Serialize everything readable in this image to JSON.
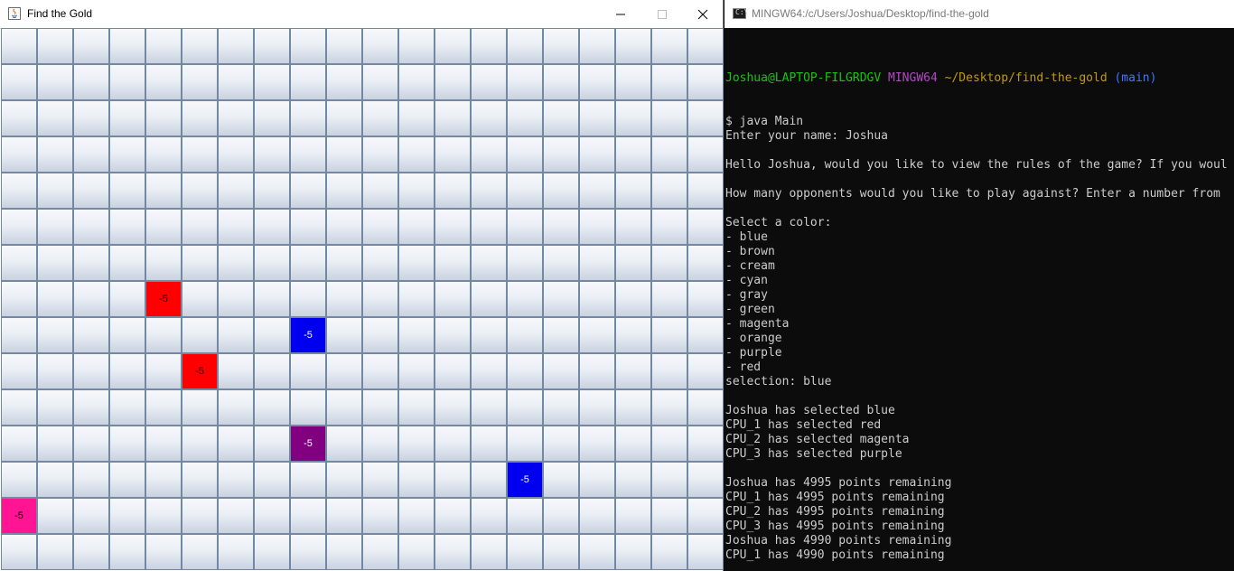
{
  "java_window": {
    "title": "Find the Gold",
    "controls": {
      "minimize": "minimize-icon",
      "maximize": "maximize-icon",
      "close": "close-icon"
    }
  },
  "board": {
    "rows": 15,
    "cols": 20,
    "marked_cells": [
      {
        "row": 7,
        "col": 4,
        "label": "-5",
        "color": "#ff0000",
        "text_color": "#000000"
      },
      {
        "row": 8,
        "col": 8,
        "label": "-5",
        "color": "#0000ee",
        "text_color": "#ffffff"
      },
      {
        "row": 9,
        "col": 5,
        "label": "-5",
        "color": "#ff0000",
        "text_color": "#000000"
      },
      {
        "row": 11,
        "col": 8,
        "label": "-5",
        "color": "#800080",
        "text_color": "#ffffff"
      },
      {
        "row": 12,
        "col": 14,
        "label": "-5",
        "color": "#0000ee",
        "text_color": "#ffffff"
      },
      {
        "row": 13,
        "col": 0,
        "label": "-5",
        "color": "#ff1493",
        "text_color": "#000000"
      }
    ]
  },
  "terminal": {
    "title": "MINGW64:/c/Users/Joshua/Desktop/find-the-gold",
    "prompt": {
      "user_host": "Joshua@LAPTOP-FILGRDGV",
      "shell": "MINGW64",
      "path": "~/Desktop/find-the-gold",
      "branch": "(main)"
    },
    "lines": [
      "$ java Main",
      "Enter your name: Joshua",
      "",
      "Hello Joshua, would you like to view the rules of the game? If you woul",
      "",
      "How many opponents would you like to play against? Enter a number from",
      "",
      "Select a color:",
      "- blue",
      "- brown",
      "- cream",
      "- cyan",
      "- gray",
      "- green",
      "- magenta",
      "- orange",
      "- purple",
      "- red",
      "selection: blue",
      "",
      "Joshua has selected blue",
      "CPU_1 has selected red",
      "CPU_2 has selected magenta",
      "CPU_3 has selected purple",
      "",
      "Joshua has 4995 points remaining",
      "CPU_1 has 4995 points remaining",
      "CPU_2 has 4995 points remaining",
      "CPU_3 has 4995 points remaining",
      "Joshua has 4990 points remaining",
      "CPU_1 has 4990 points remaining"
    ]
  }
}
